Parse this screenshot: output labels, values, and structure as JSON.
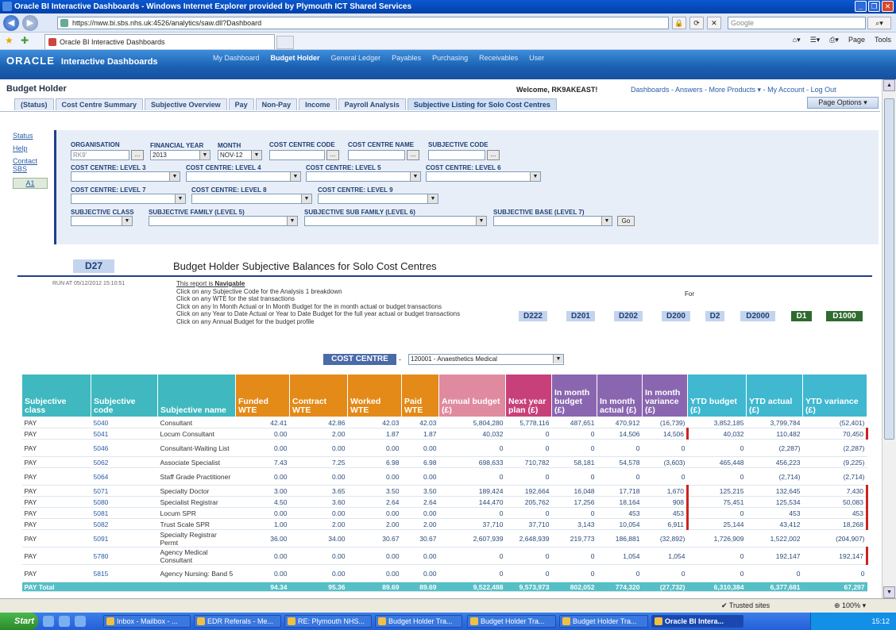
{
  "window": {
    "title": "Oracle BI Interactive Dashboards - Windows Internet Explorer provided by Plymouth ICT Shared Services",
    "url": "https://nww.bi.sbs.nhs.uk:4526/analytics/saw.dll?Dashboard",
    "search_placeholder": "Google",
    "tab_title": "Oracle BI Interactive Dashboards",
    "tools": [
      "Page",
      "Tools"
    ]
  },
  "app": {
    "brand": "ORACLE",
    "product": "Interactive Dashboards",
    "topnav": [
      {
        "label": "My Dashboard"
      },
      {
        "label": "Budget Holder",
        "selected": true
      },
      {
        "label": "General Ledger"
      },
      {
        "label": "Payables"
      },
      {
        "label": "Purchasing"
      },
      {
        "label": "Receivables"
      },
      {
        "label": "User"
      }
    ],
    "section": "Budget Holder",
    "welcome": "Welcome, RK9AKEAST!",
    "links": "Dashboards - Answers - More Products ▾ - My Account - Log Out",
    "tabs": [
      "(Status)",
      "Cost Centre Summary",
      "Subjective Overview",
      "Pay",
      "Non-Pay",
      "Income",
      "Payroll Analysis",
      "Subjective Listing for Solo Cost Centres"
    ],
    "page_options": "Page Options ▾"
  },
  "sidebar": {
    "status": "Status",
    "help": "Help",
    "contact": "Contact SBS",
    "a1": "A1"
  },
  "prompts": {
    "organisation": {
      "label": "ORGANISATION",
      "value": "RK9'"
    },
    "financial_year": {
      "label": "FINANCIAL YEAR",
      "value": "2013"
    },
    "month": {
      "label": "MONTH",
      "value": "NOV-12"
    },
    "cc_code": {
      "label": "COST CENTRE CODE",
      "value": ""
    },
    "cc_name": {
      "label": "COST CENTRE NAME",
      "value": ""
    },
    "subj_code": {
      "label": "SUBJECTIVE CODE",
      "value": ""
    },
    "level3": "COST CENTRE: LEVEL 3",
    "level4": "COST CENTRE: LEVEL 4",
    "level5": "COST CENTRE: LEVEL 5",
    "level6": "COST CENTRE: LEVEL 6",
    "level7": "COST CENTRE: LEVEL 7",
    "level8": "COST CENTRE: LEVEL 8",
    "level9": "COST CENTRE: LEVEL 9",
    "subj_class": "SUBJECTIVE CLASS",
    "subj_family": "SUBJECTIVE FAMILY (LEVEL 5)",
    "subj_subfamily": "SUBJECTIVE SUB FAMILY (LEVEL 6)",
    "subj_base": "SUBJECTIVE BASE (LEVEL 7)",
    "go": "Go"
  },
  "report": {
    "id": "D27",
    "title": "Budget Holder Subjective Balances for Solo Cost Centres",
    "run_at": "RUN AT 05/12/2012 15:10:51",
    "notes_head": "This report is",
    "notes_head_bold": "Navigable",
    "notes": [
      "Click on any Subjective Code for the Analysis 1 breakdown",
      "Click on any WTE for the stat transactions",
      "Click on any In Month Actual or In Month Budget for the in month actual or budget transactions",
      "Click on any Year to Date Actual or Year to Date Budget for the full year actual or budget transactions",
      "Click on any Annual Budget for the budget profile"
    ],
    "for_label": "For",
    "drill_buttons": [
      "D222",
      "D201",
      "D202",
      "D200",
      "D2",
      "D2000",
      "D1",
      "D1000"
    ],
    "cost_centre_label": "COST CENTRE",
    "cost_centre_dash": "-",
    "cost_centre_value": "120001 - Anaesthetics Medical"
  },
  "table": {
    "headers": [
      "Subjective class",
      "Subjective code",
      "Subjective name",
      "Funded WTE",
      "Contract WTE",
      "Worked WTE",
      "Paid WTE",
      "Annual budget (£)",
      "Next year plan (£)",
      "In month budget (£)",
      "In month actual (£)",
      "In month variance (£)",
      "YTD budget (£)",
      "YTD actual (£)",
      "YTD variance (£)"
    ],
    "rows": [
      [
        "PAY",
        "5040",
        "Consultant",
        "42.41",
        "42.86",
        "42.03",
        "42.03",
        "5,804,280",
        "5,778,116",
        "487,651",
        "470,912",
        "(16,739)",
        "3,852,185",
        "3,799,784",
        "(52,401)"
      ],
      [
        "PAY",
        "5041",
        "Locum Consultant",
        "0.00",
        "2.00",
        "1.87",
        "1.87",
        "40,032",
        "0",
        "0",
        "14,506",
        "14,506",
        "40,032",
        "110,482",
        "70,450"
      ],
      [
        "PAY",
        "5046",
        "Consultant-Waiting List",
        "0.00",
        "0.00",
        "0.00",
        "0.00",
        "0",
        "0",
        "0",
        "0",
        "0",
        "0",
        "(2,287)",
        "(2,287)"
      ],
      [
        "PAY",
        "5062",
        "Associate Specialist",
        "7.43",
        "7.25",
        "6.98",
        "6.98",
        "698,633",
        "710,782",
        "58,181",
        "54,578",
        "(3,603)",
        "465,448",
        "456,223",
        "(9,225)"
      ],
      [
        "PAY",
        "5064",
        "Staff Grade Practitioner",
        "0.00",
        "0.00",
        "0.00",
        "0.00",
        "0",
        "0",
        "0",
        "0",
        "0",
        "0",
        "(2,714)",
        "(2,714)"
      ],
      [
        "PAY",
        "5071",
        "Specialty Doctor",
        "3.00",
        "3.65",
        "3.50",
        "3.50",
        "189,424",
        "192,664",
        "16,048",
        "17,718",
        "1,670",
        "125,215",
        "132,645",
        "7,430"
      ],
      [
        "PAY",
        "5080",
        "Specialist Registrar",
        "4.50",
        "3.60",
        "2.64",
        "2.64",
        "144,470",
        "205,762",
        "17,256",
        "18,164",
        "908",
        "75,451",
        "125,534",
        "50,083"
      ],
      [
        "PAY",
        "5081",
        "Locum SPR",
        "0.00",
        "0.00",
        "0.00",
        "0.00",
        "0",
        "0",
        "0",
        "453",
        "453",
        "0",
        "453",
        "453"
      ],
      [
        "PAY",
        "5082",
        "Trust Scale SPR",
        "1.00",
        "2.00",
        "2.00",
        "2.00",
        "37,710",
        "37,710",
        "3,143",
        "10,054",
        "6,911",
        "25,144",
        "43,412",
        "18,268"
      ],
      [
        "PAY",
        "5091",
        "Specialty Registrar Permt",
        "36.00",
        "34.00",
        "30.67",
        "30.67",
        "2,607,939",
        "2,648,939",
        "219,773",
        "186,881",
        "(32,892)",
        "1,726,909",
        "1,522,002",
        "(204,907)"
      ],
      [
        "PAY",
        "5780",
        "Agency Medical Consultant",
        "0.00",
        "0.00",
        "0.00",
        "0.00",
        "0",
        "0",
        "0",
        "1,054",
        "1,054",
        "0",
        "192,147",
        "192,147"
      ],
      [
        "PAY",
        "5815",
        "Agency Nursing: Band 5",
        "0.00",
        "0.00",
        "0.00",
        "0.00",
        "0",
        "0",
        "0",
        "0",
        "0",
        "0",
        "0",
        "0"
      ]
    ],
    "total": [
      "PAY Total",
      "",
      "",
      "94.34",
      "95.36",
      "89.69",
      "89.69",
      "9,522,488",
      "9,573,973",
      "802,052",
      "774,320",
      "(27,732)",
      "6,310,384",
      "6,377,681",
      "67,297"
    ]
  },
  "statusbar": {
    "trusted": "Trusted sites",
    "zoom": "100%"
  },
  "taskbar": {
    "start": "Start",
    "items": [
      "Inbox - Mailbox - ...",
      "EDR Referals - Me...",
      "RE: Plymouth NHS...",
      "Budget Holder Tra...",
      "Budget Holder Tra...",
      "Budget Holder Tra...",
      "Oracle BI Intera..."
    ],
    "time": "15:12"
  }
}
